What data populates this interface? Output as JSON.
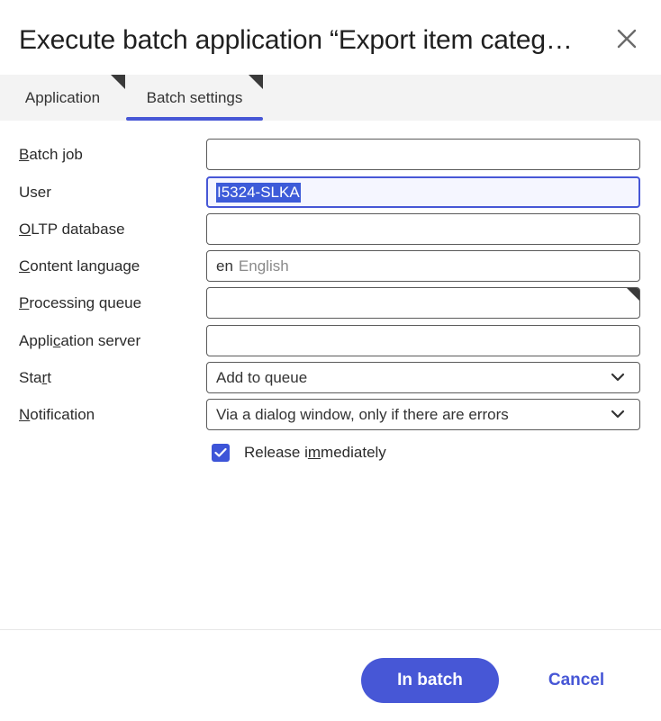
{
  "dialog": {
    "title": "Execute batch application “Export item categ…",
    "close_icon": "close-icon"
  },
  "tabs": [
    {
      "label": "Application",
      "active": false
    },
    {
      "label": "Batch settings",
      "active": true
    }
  ],
  "form": {
    "batch_job": {
      "label_u": "B",
      "label_rest": "atch job",
      "value": ""
    },
    "user": {
      "label": "User",
      "value": "I5324-SLKA"
    },
    "oltp_database": {
      "label_u": "O",
      "label_rest": "LTP database",
      "value": ""
    },
    "content_language": {
      "label_u": "C",
      "label_rest": "ontent language",
      "code": "en",
      "description": "English"
    },
    "processing_queue": {
      "label_u": "P",
      "label_rest": "rocessing queue",
      "value": ""
    },
    "application_server": {
      "label_pre": "Appli",
      "label_u": "c",
      "label_rest": "ation server",
      "value": ""
    },
    "start": {
      "label_pre": "Sta",
      "label_u": "r",
      "label_rest": "t",
      "value": "Add to queue"
    },
    "notification": {
      "label_u": "N",
      "label_rest": "otification",
      "value": "Via a dialog window, only if there are errors"
    },
    "release_immediately": {
      "label_pre": "Release i",
      "label_u": "m",
      "label_rest": "mediately",
      "checked": true
    }
  },
  "footer": {
    "primary_label": "In batch",
    "cancel_label": "Cancel"
  },
  "colors": {
    "accent": "#4757d6",
    "selection": "#3d5bd9",
    "tabbar_bg": "#f3f3f3"
  }
}
